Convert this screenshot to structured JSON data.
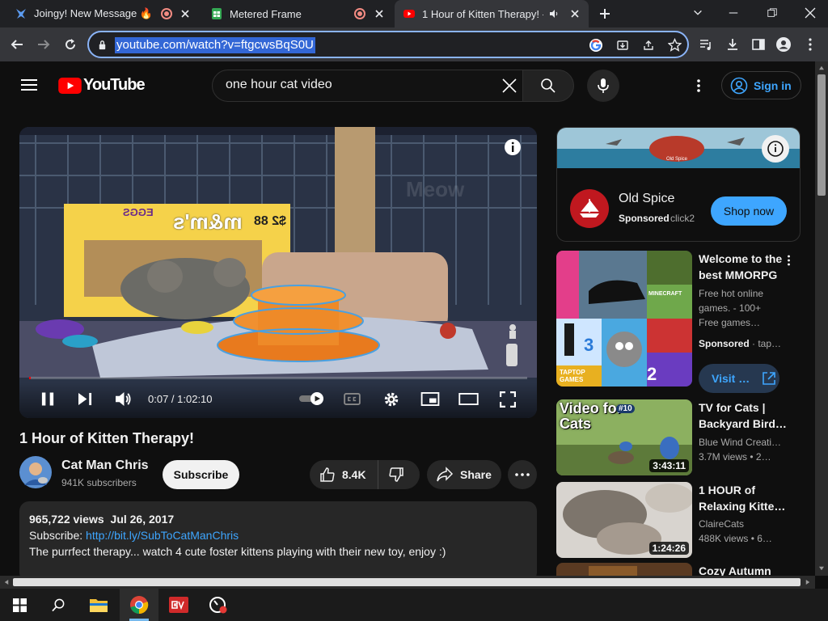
{
  "browser": {
    "tabs": [
      {
        "title": "Joingy! New Message 🔥"
      },
      {
        "title": ""
      },
      {
        "title": "Metered Frame"
      },
      {
        "title": ""
      },
      {
        "title": "1 Hour of Kitten Therapy! - Y"
      }
    ],
    "url": "youtube.com/watch?v=ftgcwsBqS0U"
  },
  "youtube": {
    "logo_text": "YouTube",
    "search_value": "one hour cat video",
    "sign_in": "Sign in"
  },
  "player": {
    "time": "0:07 / 1:02:10",
    "progress": 0.002,
    "overlay_text": "Meow"
  },
  "video": {
    "title": "1 Hour of Kitten Therapy!",
    "channel": "Cat Man Chris",
    "subscribers": "941K subscribers",
    "subscribe": "Subscribe",
    "likes": "8.4K",
    "share": "Share",
    "views": "965,722 views",
    "date": "Jul 26, 2017",
    "desc_prefix": "Subscribe:",
    "desc_link": "http://bit.ly/SubToCatManChris",
    "desc_text": "The purrfect therapy... watch 4 cute foster kittens playing with their new toy, enjoy :)"
  },
  "ad": {
    "brand": "Old Spice",
    "sponsored": "Sponsored",
    "site": "click2",
    "cta": "Shop now",
    "banner_text": "Old Spice"
  },
  "sidebar": [
    {
      "title_line1": "Welcome to the",
      "title_line2": "best MMORPG",
      "meta": [
        "Free hot online",
        "games. - 100+",
        "Free games…"
      ],
      "sponsored": "Sponsored",
      "site": "tap…",
      "cta": "Visit …"
    },
    {
      "title_line1": "TV for Cats |",
      "title_line2": "Backyard Bird…",
      "channel": "Blue Wind Creati…",
      "views": "3.7M views",
      "age": "2…",
      "duration": "3:43:11",
      "thumb_text": "Video for Cats",
      "thumb_badge": "#10"
    },
    {
      "title_line1": "1 HOUR of",
      "title_line2": "Relaxing Kitte…",
      "channel": "ClaireCats",
      "views": "488K views",
      "age": "6…",
      "duration": "1:24:26"
    },
    {
      "title_line1": "Cozy Autumn"
    }
  ],
  "game_thumb": {
    "badge_2": "2",
    "badge_3": "3",
    "logo": "TAPTOP GAMES",
    "mine": "MINECRAFT"
  },
  "scene": {
    "box_label": "m&m's",
    "box_price": "$2 88",
    "box_eggs": "EGGS"
  }
}
